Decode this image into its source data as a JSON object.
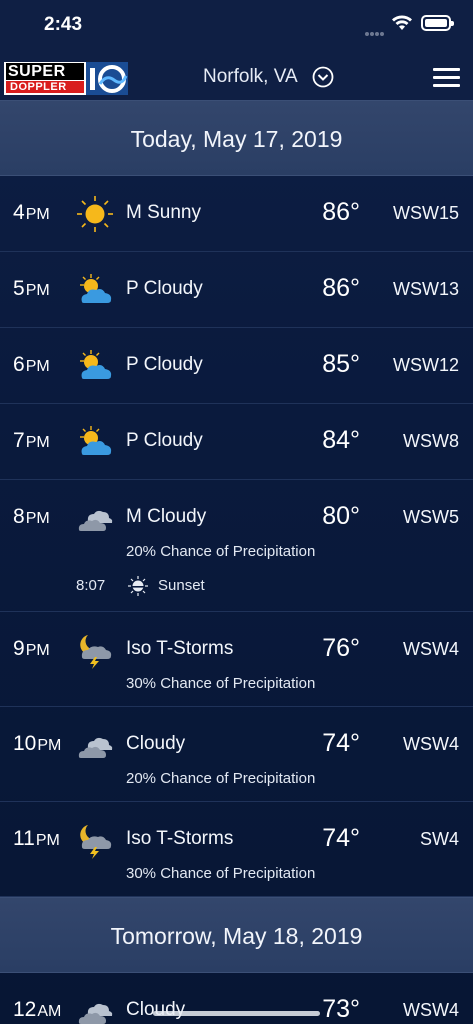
{
  "status": {
    "time": "2:43"
  },
  "header": {
    "logo_top": "SUPER",
    "logo_bottom": "DOPPLER",
    "location": "Norfolk, VA"
  },
  "days": [
    {
      "label": "Today, May 17, 2019",
      "hours": [
        {
          "hour": "4",
          "ampm": "PM",
          "icon": "sun-icon",
          "condition": "M Sunny",
          "temp": "86°",
          "wind": "WSW15"
        },
        {
          "hour": "5",
          "ampm": "PM",
          "icon": "partly-cloudy-icon",
          "condition": "P Cloudy",
          "temp": "86°",
          "wind": "WSW13"
        },
        {
          "hour": "6",
          "ampm": "PM",
          "icon": "partly-cloudy-icon",
          "condition": "P Cloudy",
          "temp": "85°",
          "wind": "WSW12"
        },
        {
          "hour": "7",
          "ampm": "PM",
          "icon": "partly-cloudy-icon",
          "condition": "P Cloudy",
          "temp": "84°",
          "wind": "WSW8"
        },
        {
          "hour": "8",
          "ampm": "PM",
          "icon": "mostly-cloudy-icon",
          "condition": "M Cloudy",
          "temp": "80°",
          "wind": "WSW5",
          "precip": "20% Chance of Precipitation",
          "sunset_time": "8:07",
          "sunset_label": "Sunset"
        },
        {
          "hour": "9",
          "ampm": "PM",
          "icon": "thunderstorm-night-icon",
          "condition": "Iso T-Storms",
          "temp": "76°",
          "wind": "WSW4",
          "precip": "30% Chance of Precipitation"
        },
        {
          "hour": "10",
          "ampm": "PM",
          "icon": "cloudy-icon",
          "condition": "Cloudy",
          "temp": "74°",
          "wind": "WSW4",
          "precip": "20% Chance of Precipitation"
        },
        {
          "hour": "11",
          "ampm": "PM",
          "icon": "thunderstorm-night-icon",
          "condition": "Iso T-Storms",
          "temp": "74°",
          "wind": "SW4",
          "precip": "30% Chance of Precipitation"
        }
      ]
    },
    {
      "label": "Tomorrow, May 18, 2019",
      "hours": [
        {
          "hour": "12",
          "ampm": "AM",
          "icon": "cloudy-icon",
          "condition": "Cloudy",
          "temp": "73°",
          "wind": "WSW4"
        }
      ]
    }
  ],
  "colors": {
    "accent_sun": "#f6b81b",
    "cloud": "#3a9ae0",
    "bolt": "#f0c020"
  }
}
